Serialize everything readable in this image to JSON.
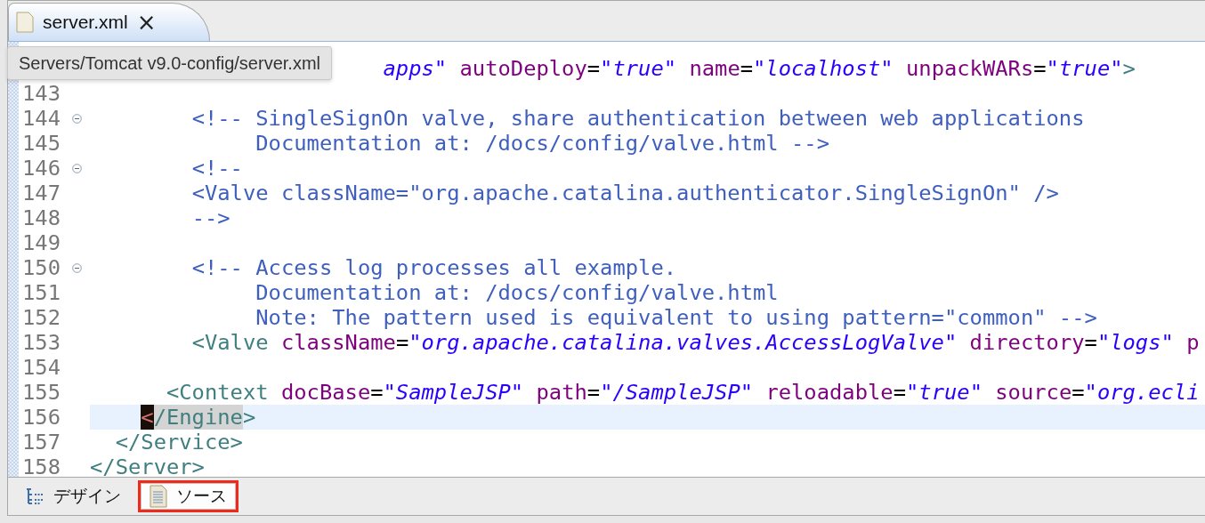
{
  "editor_tab": {
    "title": "server.xml",
    "close": "×",
    "selected": true
  },
  "tooltip": "Servers/Tomcat v9.0-config/server.xml",
  "lines": [
    {
      "fold": false,
      "current": false,
      "tokens": [
        {
          "kind": "value",
          "text": "                       apps\""
        },
        {
          "kind": "attr",
          "text": " autoDeploy"
        },
        {
          "kind": "eq",
          "text": "="
        },
        {
          "kind": "value",
          "text": "\"true\""
        },
        {
          "kind": "attr",
          "text": " name"
        },
        {
          "kind": "eq",
          "text": "="
        },
        {
          "kind": "value",
          "text": "\"localhost\""
        },
        {
          "kind": "attr",
          "text": " unpackWARs"
        },
        {
          "kind": "eq",
          "text": "="
        },
        {
          "kind": "value",
          "text": "\"true\""
        },
        {
          "kind": "tag",
          "text": ">"
        }
      ]
    },
    {
      "number": "143",
      "fold": false,
      "current": false
    },
    {
      "number": "144",
      "fold": true,
      "current": false,
      "tokens": [
        {
          "kind": "comment",
          "text": "        <!-- SingleSignOn valve, share authentication between web applications"
        }
      ]
    },
    {
      "number": "145",
      "fold": false,
      "current": false,
      "tokens": [
        {
          "kind": "comment",
          "text": "             Documentation at: /docs/config/valve.html -->"
        }
      ]
    },
    {
      "number": "146",
      "fold": true,
      "current": false,
      "tokens": [
        {
          "kind": "comment",
          "text": "        <!--"
        }
      ]
    },
    {
      "number": "147",
      "fold": false,
      "current": false,
      "tokens": [
        {
          "kind": "comment",
          "text": "        <Valve className=\"org.apache.catalina.authenticator.SingleSignOn\" />"
        }
      ]
    },
    {
      "number": "148",
      "fold": false,
      "current": false,
      "tokens": [
        {
          "kind": "comment",
          "text": "        -->"
        }
      ]
    },
    {
      "number": "149",
      "fold": false,
      "current": false
    },
    {
      "number": "150",
      "fold": true,
      "current": false,
      "tokens": [
        {
          "kind": "comment",
          "text": "        <!-- Access log processes all example."
        }
      ]
    },
    {
      "number": "151",
      "fold": false,
      "current": false,
      "tokens": [
        {
          "kind": "comment",
          "text": "             Documentation at: /docs/config/valve.html"
        }
      ]
    },
    {
      "number": "152",
      "fold": false,
      "current": false,
      "tokens": [
        {
          "kind": "comment",
          "text": "             Note: The pattern used is equivalent to using pattern=\"common\" -->"
        }
      ]
    },
    {
      "number": "153",
      "fold": false,
      "current": false,
      "tokens": [
        {
          "kind": "tag",
          "text": "        <Valve"
        },
        {
          "kind": "attr",
          "text": " className"
        },
        {
          "kind": "eq",
          "text": "="
        },
        {
          "kind": "value",
          "text": "\"org.apache.catalina.valves.AccessLogValve\""
        },
        {
          "kind": "attr",
          "text": " directory"
        },
        {
          "kind": "eq",
          "text": "="
        },
        {
          "kind": "value",
          "text": "\"logs\""
        },
        {
          "kind": "attr",
          "text": " p"
        }
      ]
    },
    {
      "number": "154",
      "fold": false,
      "current": false
    },
    {
      "number": "155",
      "fold": false,
      "current": false,
      "tokens": [
        {
          "kind": "tag",
          "text": "      <Context"
        },
        {
          "kind": "attr",
          "text": " docBase"
        },
        {
          "kind": "eq",
          "text": "="
        },
        {
          "kind": "value",
          "text": "\"SampleJSP\""
        },
        {
          "kind": "attr",
          "text": " path"
        },
        {
          "kind": "eq",
          "text": "="
        },
        {
          "kind": "value",
          "text": "\"/SampleJSP\""
        },
        {
          "kind": "attr",
          "text": " reloadable"
        },
        {
          "kind": "eq",
          "text": "="
        },
        {
          "kind": "value",
          "text": "\"true\""
        },
        {
          "kind": "attr",
          "text": " source"
        },
        {
          "kind": "eq",
          "text": "="
        },
        {
          "kind": "value",
          "text": "\"org.ecli"
        }
      ]
    },
    {
      "number": "156",
      "fold": false,
      "current": true,
      "tokens": [
        {
          "kind": "cursor",
          "text": "    <"
        },
        {
          "kind": "match",
          "text": "/Engine"
        },
        {
          "kind": "tag",
          "text": ">"
        }
      ]
    },
    {
      "number": "157",
      "fold": false,
      "current": false,
      "tokens": [
        {
          "kind": "tag",
          "text": "  </Service>"
        }
      ]
    },
    {
      "number": "158",
      "fold": false,
      "current": false,
      "tokens": [
        {
          "kind": "tag",
          "text": "</Server>"
        }
      ]
    }
  ],
  "bottom_tabs": [
    {
      "kind": "design",
      "label": "デザイン",
      "selected": false,
      "annotated": false
    },
    {
      "kind": "source",
      "label": "ソース",
      "selected": true,
      "annotated": true
    }
  ]
}
